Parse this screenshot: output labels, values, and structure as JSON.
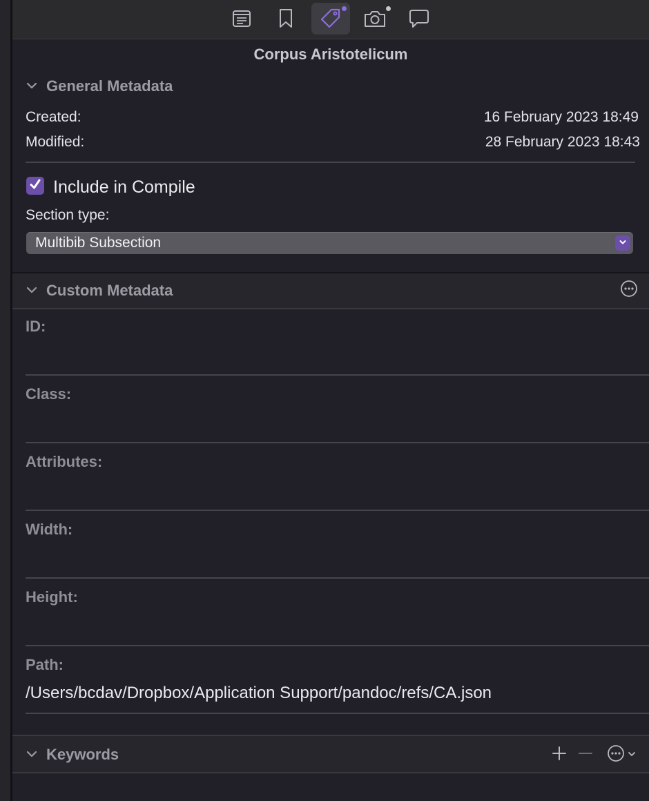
{
  "toolbar": {
    "tabs": [
      {
        "name": "notes",
        "icon": "notes-icon"
      },
      {
        "name": "bookmarks",
        "icon": "bookmark-icon"
      },
      {
        "name": "metadata",
        "icon": "tag-icon",
        "active": true
      },
      {
        "name": "snapshots",
        "icon": "camera-icon"
      },
      {
        "name": "comments",
        "icon": "speech-bubble-icon"
      }
    ],
    "accent": "#8c6fd9"
  },
  "document_title": "Corpus Aristotelicum",
  "general_metadata": {
    "header": "General Metadata",
    "created_label": "Created:",
    "created_value": "16 February 2023 18:49",
    "modified_label": "Modified:",
    "modified_value": "28 February 2023 18:43",
    "include_in_compile_label": "Include in Compile",
    "include_in_compile_checked": true,
    "section_type_label": "Section type:",
    "section_type_value": "Multibib Subsection"
  },
  "custom_metadata": {
    "header": "Custom Metadata",
    "fields": [
      {
        "label": "ID:",
        "value": ""
      },
      {
        "label": "Class:",
        "value": ""
      },
      {
        "label": "Attributes:",
        "value": ""
      },
      {
        "label": "Width:",
        "value": ""
      },
      {
        "label": "Height:",
        "value": ""
      },
      {
        "label": "Path:",
        "value": "/Users/bcdav/Dropbox/Application Support/pandoc/refs/CA.json"
      }
    ]
  },
  "keywords": {
    "header": "Keywords"
  }
}
